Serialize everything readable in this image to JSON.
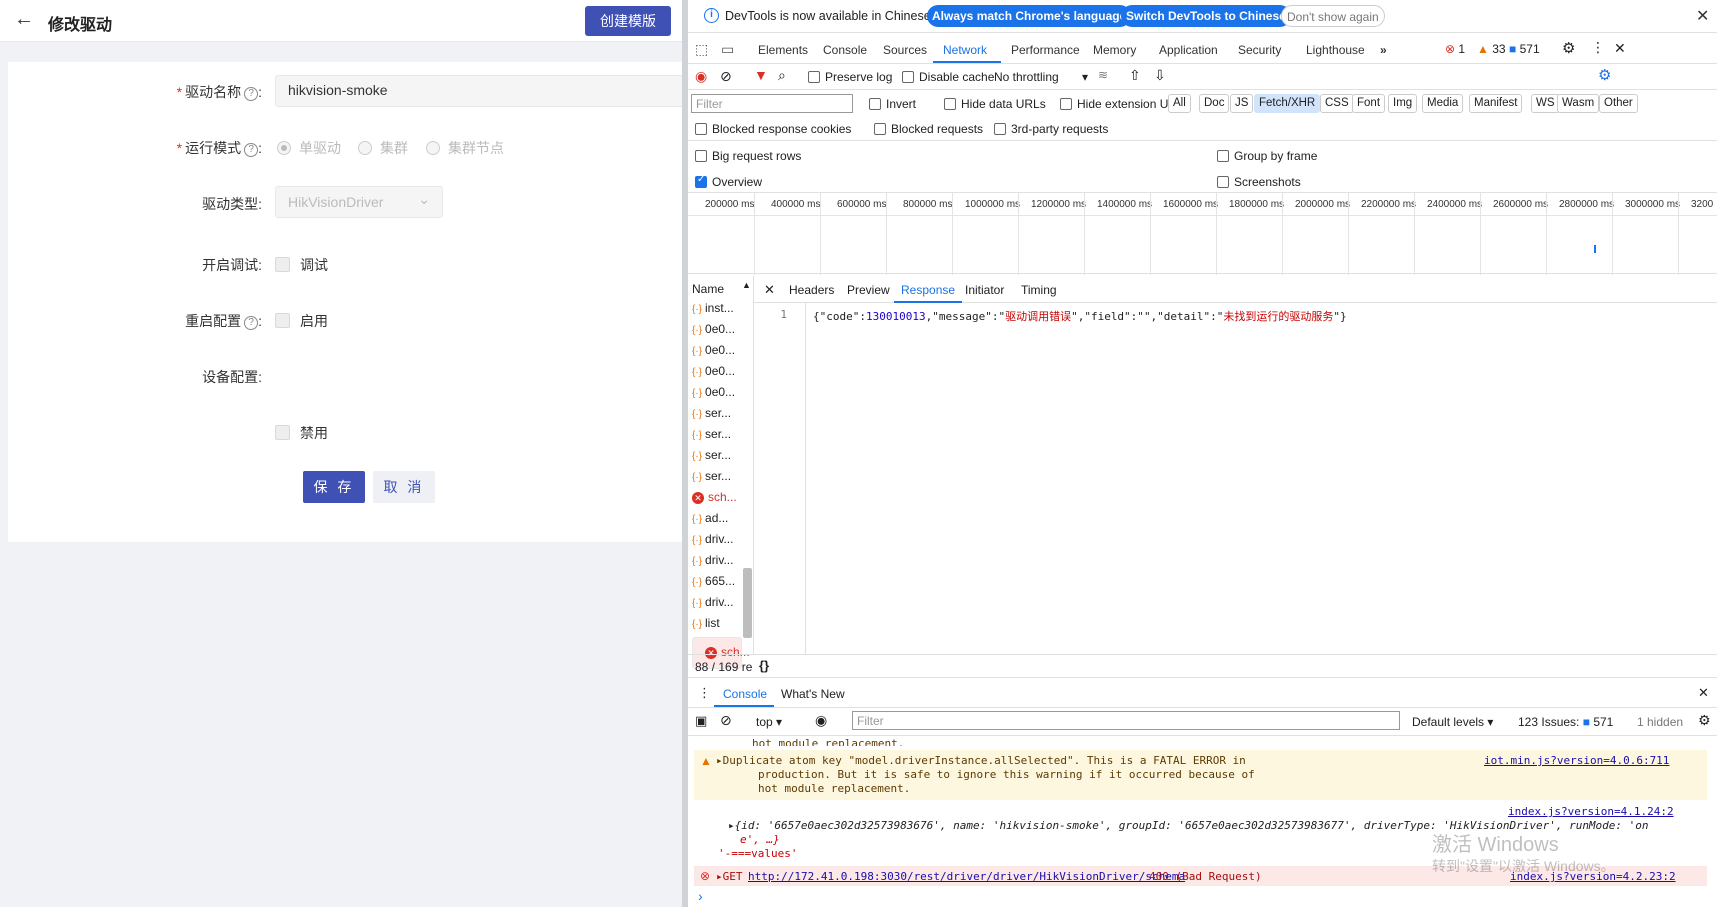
{
  "app": {
    "back_icon": "arrow-left-icon",
    "page_title": "修改驱动",
    "create_template_label": "创建模版",
    "form": {
      "name_label": "驱动名称",
      "name_value": "hikvision-smoke",
      "mode_label": "运行模式",
      "mode_options": [
        "单驱动",
        "集群",
        "集群节点"
      ],
      "mode_selected": "单驱动",
      "type_label": "驱动类型:",
      "type_value": "HikVisionDriver",
      "debug_label": "开启调试:",
      "debug_checkbox": "调试",
      "restart_label": "重启配置",
      "restart_checkbox": "启用",
      "device_label": "设备配置:",
      "disable_checkbox": "禁用",
      "save_label": "保 存",
      "cancel_label": "取 消",
      "colon": ":"
    }
  },
  "devtools": {
    "info_message": "DevTools is now available in Chinese!",
    "btn_match": "Always match Chrome's language",
    "btn_switch": "Switch DevTools to Chinese",
    "btn_dismiss": "Don't show again",
    "tabs": [
      "Elements",
      "Console",
      "Sources",
      "Network",
      "Performance",
      "Memory",
      "Application",
      "Security",
      "Lighthouse"
    ],
    "active_tab": "Network",
    "badges": {
      "errors": "1",
      "warnings": "33",
      "messages": "571"
    },
    "toolbar": {
      "preserve_log": "Preserve log",
      "disable_cache": "Disable cache",
      "throttling": "No throttling"
    },
    "filter_placeholder": "Filter",
    "invert": "Invert",
    "hide_data": "Hide data URLs",
    "hide_ext": "Hide extension URLs",
    "chips": [
      "All",
      "Doc",
      "JS",
      "Fetch/XHR",
      "CSS",
      "Font",
      "Img",
      "Media",
      "Manifest",
      "WS",
      "Wasm",
      "Other"
    ],
    "active_chip": "Fetch/XHR",
    "blocked_cookies": "Blocked response cookies",
    "blocked_requests": "Blocked requests",
    "third_party": "3rd-party requests",
    "big_rows": "Big request rows",
    "group_frame": "Group by frame",
    "overview": "Overview",
    "screenshots": "Screenshots",
    "timeline_ticks": [
      "200000 ms",
      "400000 ms",
      "600000 ms",
      "800000 ms",
      "1000000 ms",
      "1200000 ms",
      "1400000 ms",
      "1600000 ms",
      "1800000 ms",
      "2000000 ms",
      "2200000 ms",
      "2400000 ms",
      "2600000 ms",
      "2800000 ms",
      "3000000 ms",
      "3200"
    ],
    "name_header": "Name",
    "requests": [
      {
        "name": "inst...",
        "error": false
      },
      {
        "name": "0e0...",
        "error": false
      },
      {
        "name": "0e0...",
        "error": false
      },
      {
        "name": "0e0...",
        "error": false
      },
      {
        "name": "0e0...",
        "error": false
      },
      {
        "name": "ser...",
        "error": false
      },
      {
        "name": "ser...",
        "error": false
      },
      {
        "name": "ser...",
        "error": false
      },
      {
        "name": "ser...",
        "error": false
      },
      {
        "name": "sch...",
        "error": true
      },
      {
        "name": "ad...",
        "error": false
      },
      {
        "name": "driv...",
        "error": false
      },
      {
        "name": "driv...",
        "error": false
      },
      {
        "name": "665...",
        "error": false
      },
      {
        "name": "driv...",
        "error": false
      },
      {
        "name": "list",
        "error": false
      },
      {
        "name": "sch...",
        "error": true
      }
    ],
    "detail_tabs": [
      "Headers",
      "Preview",
      "Response",
      "Initiator",
      "Timing"
    ],
    "active_detail_tab": "Response",
    "response_line_no": "1",
    "response": {
      "code": "130010013",
      "message": "驱动调用错误",
      "field": "",
      "detail": "未找到运行的驱动服务"
    },
    "status": "88 / 169 re",
    "drawer_tabs": [
      "Console",
      "What's New"
    ],
    "console": {
      "context": "top",
      "filter_placeholder": "Filter",
      "levels": "Default levels",
      "issues": "123 Issues:",
      "issues_count": "571",
      "hidden": "1 hidden",
      "prev_tail": "hot module replacement.",
      "warn_lines": [
        "Duplicate atom key \"model.driverInstance.allSelected\". This is a FATAL ERROR in",
        "production. But it is safe to ignore this warning if it occurred because of",
        "hot module replacement."
      ],
      "warn_src": "iot.min.js?version=4.0.6:711",
      "log_src": "index.js?version=4.1.24:2",
      "log_line1": "{id: '6657e0aec302d32573983676', name: 'hikvision-smoke', groupId: '6657e0aec302d32573983677', driverType: 'HikVisionDriver', runMode: 'on",
      "log_line2": "e', …}",
      "log_line3": "'-===values'",
      "err_method": "GET",
      "err_url": "http://172.41.0.198:3030/rest/driver/driver/HikVisionDriver/schema",
      "err_status": "400 (Bad Request)",
      "err_src": "index.js?version=4.2.23:2",
      "prompt": "›"
    }
  },
  "watermark": {
    "line1": "激活 Windows",
    "line2": "转到\"设置\"以激活 Windows。"
  }
}
